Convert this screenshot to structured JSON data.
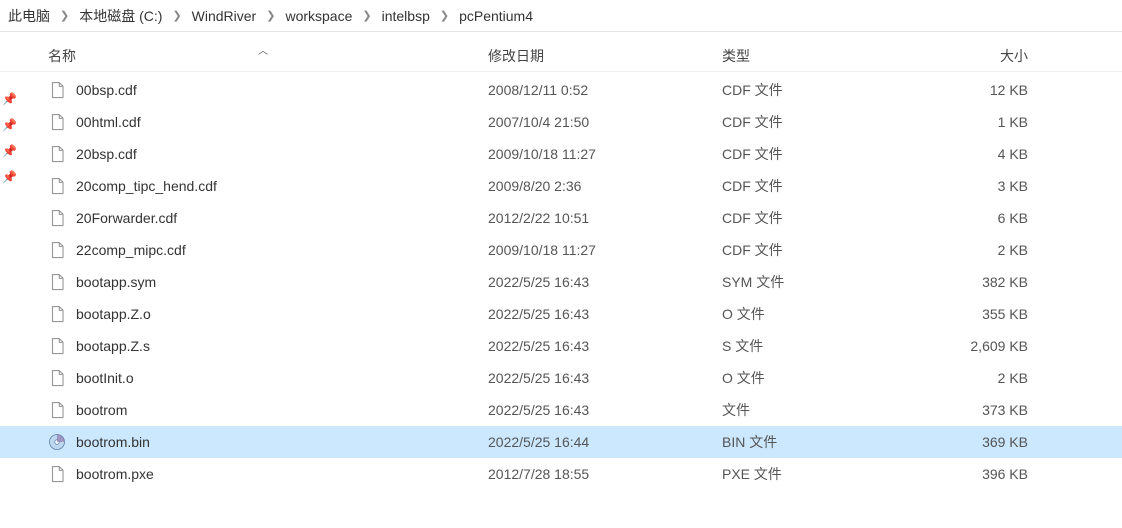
{
  "breadcrumb": [
    "此电脑",
    "本地磁盘 (C:)",
    "WindRiver",
    "workspace",
    "intelbsp",
    "pcPentium4"
  ],
  "columns": {
    "name": "名称",
    "date": "修改日期",
    "type": "类型",
    "size": "大小"
  },
  "files": [
    {
      "name": "00bsp.cdf",
      "date": "2008/12/11 0:52",
      "type": "CDF 文件",
      "size": "12 KB",
      "icon": "file",
      "selected": false
    },
    {
      "name": "00html.cdf",
      "date": "2007/10/4 21:50",
      "type": "CDF 文件",
      "size": "1 KB",
      "icon": "file",
      "selected": false
    },
    {
      "name": "20bsp.cdf",
      "date": "2009/10/18 11:27",
      "type": "CDF 文件",
      "size": "4 KB",
      "icon": "file",
      "selected": false
    },
    {
      "name": "20comp_tipc_hend.cdf",
      "date": "2009/8/20 2:36",
      "type": "CDF 文件",
      "size": "3 KB",
      "icon": "file",
      "selected": false
    },
    {
      "name": "20Forwarder.cdf",
      "date": "2012/2/22 10:51",
      "type": "CDF 文件",
      "size": "6 KB",
      "icon": "file",
      "selected": false
    },
    {
      "name": "22comp_mipc.cdf",
      "date": "2009/10/18 11:27",
      "type": "CDF 文件",
      "size": "2 KB",
      "icon": "file",
      "selected": false
    },
    {
      "name": "bootapp.sym",
      "date": "2022/5/25 16:43",
      "type": "SYM 文件",
      "size": "382 KB",
      "icon": "file",
      "selected": false
    },
    {
      "name": "bootapp.Z.o",
      "date": "2022/5/25 16:43",
      "type": "O 文件",
      "size": "355 KB",
      "icon": "file",
      "selected": false
    },
    {
      "name": "bootapp.Z.s",
      "date": "2022/5/25 16:43",
      "type": "S 文件",
      "size": "2,609 KB",
      "icon": "file",
      "selected": false
    },
    {
      "name": "bootInit.o",
      "date": "2022/5/25 16:43",
      "type": "O 文件",
      "size": "2 KB",
      "icon": "file",
      "selected": false
    },
    {
      "name": "bootrom",
      "date": "2022/5/25 16:43",
      "type": "文件",
      "size": "373 KB",
      "icon": "file",
      "selected": false
    },
    {
      "name": "bootrom.bin",
      "date": "2022/5/25 16:44",
      "type": "BIN 文件",
      "size": "369 KB",
      "icon": "disc",
      "selected": true
    },
    {
      "name": "bootrom.pxe",
      "date": "2012/7/28 18:55",
      "type": "PXE 文件",
      "size": "396 KB",
      "icon": "file",
      "selected": false
    }
  ]
}
